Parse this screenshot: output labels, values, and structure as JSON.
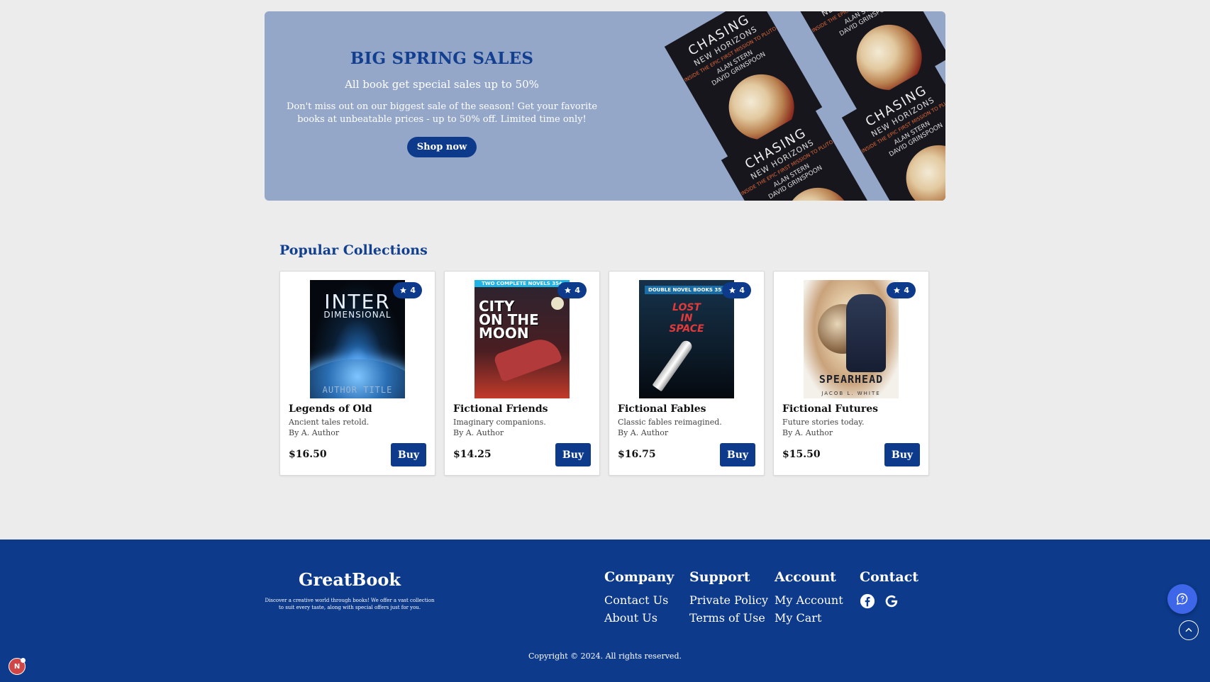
{
  "hero": {
    "title": "BIG SPRING SALES",
    "subtitle": "All book get special sales up to 50%",
    "description": "Don't miss out on our biggest sale of the season! Get your favorite books at unbeatable prices - up to 50% off. Limited time only!",
    "button_label": "Shop now",
    "cover": {
      "title_line1": "CHASING",
      "title_line2": "NEW HORIZONS",
      "tagline": "INSIDE THE EPIC FIRST MISSION TO PLUTO",
      "author1": "ALAN STERN",
      "author2": "DAVID GRINSPOON"
    }
  },
  "collections": {
    "title": "Popular Collections",
    "books": [
      {
        "title": "Legends of Old",
        "desc": "Ancient tales retold.",
        "author": "By A. Author",
        "price": "$16.50",
        "rating": "4",
        "buy_label": "Buy",
        "cover": {
          "line1": "INTER",
          "line2": "DIMENSIONAL",
          "line3": "AUTHOR TITLE"
        }
      },
      {
        "title": "Fictional Friends",
        "desc": "Imaginary companions.",
        "author": "By A. Author",
        "price": "$14.25",
        "rating": "4",
        "buy_label": "Buy",
        "cover": {
          "banner": "TWO COMPLETE NOVELS 35¢",
          "line1": "CITY ON THE MOON"
        }
      },
      {
        "title": "Fictional Fables",
        "desc": "Classic fables reimagined.",
        "author": "By A. Author",
        "price": "$16.75",
        "rating": "4",
        "buy_label": "Buy",
        "cover": {
          "banner": "DOUBLE NOVEL BOOKS 35¢",
          "line1": "LOST IN SPACE"
        }
      },
      {
        "title": "Fictional Futures",
        "desc": "Future stories today.",
        "author": "By A. Author",
        "price": "$15.50",
        "rating": "4",
        "buy_label": "Buy",
        "cover": {
          "line1": "SPEARHEAD",
          "line2": "JACOB L. WHITE"
        }
      }
    ]
  },
  "footer": {
    "brand": "GreatBook",
    "brand_desc": "Discover a creative world through books! We offer a vast collection to suit every taste, along with special offers just for you.",
    "columns": [
      {
        "heading": "Company",
        "links": [
          "Contact Us",
          "About Us"
        ]
      },
      {
        "heading": "Support",
        "links": [
          "Private Policy",
          "Terms of Use"
        ]
      },
      {
        "heading": "Account",
        "links": [
          "My Account",
          "My Cart"
        ]
      },
      {
        "heading": "Contact",
        "socials": [
          "facebook-icon",
          "google-icon"
        ]
      }
    ],
    "copyright": "Copyright © 2024. All rights reserved."
  },
  "widgets": {
    "badge_letter": "N"
  },
  "colors": {
    "primary": "#0d3a8b",
    "hero_bg": "#94a7c9",
    "page_bg": "#ececec",
    "accent": "#3d66e8"
  }
}
